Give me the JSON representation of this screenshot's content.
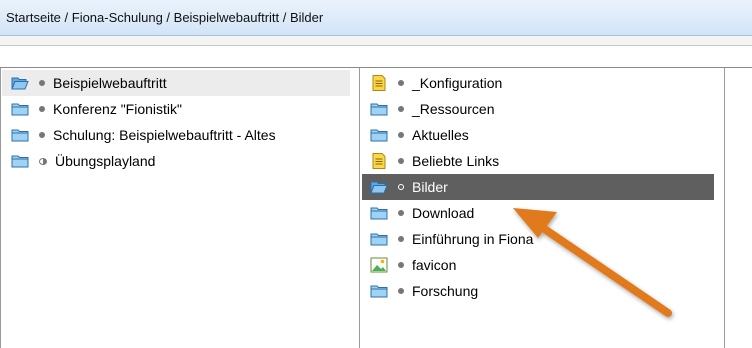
{
  "breadcrumb": "Startseite / Fiona-Schulung / Beispielwebauftritt / Bilder",
  "left_pane": {
    "items": [
      {
        "label": "Beispielwebauftritt",
        "icon": "folder-open-icon",
        "selected": true
      },
      {
        "label": "Konferenz \"Fionistik\"",
        "icon": "folder-icon"
      },
      {
        "label": "Schulung: Beispielwebauftritt - Altes",
        "icon": "folder-icon"
      },
      {
        "label": "Übungsplayland",
        "icon": "folder-icon"
      }
    ]
  },
  "right_pane": {
    "items": [
      {
        "label": "_Konfiguration",
        "icon": "document-icon"
      },
      {
        "label": "_Ressourcen",
        "icon": "folder-icon"
      },
      {
        "label": "Aktuelles",
        "icon": "folder-icon"
      },
      {
        "label": "Beliebte Links",
        "icon": "document-icon"
      },
      {
        "label": "Bilder",
        "icon": "folder-open-icon",
        "selected": true
      },
      {
        "label": "Download",
        "icon": "folder-icon"
      },
      {
        "label": "Einführung in Fiona",
        "icon": "folder-icon"
      },
      {
        "label": "favicon",
        "icon": "image-icon"
      },
      {
        "label": "Forschung",
        "icon": "folder-icon"
      }
    ]
  },
  "colors": {
    "selection_dark": "#5f5f5f",
    "arrow": "#e07a1a",
    "breadcrumb_bg": "#d2e4f7"
  }
}
